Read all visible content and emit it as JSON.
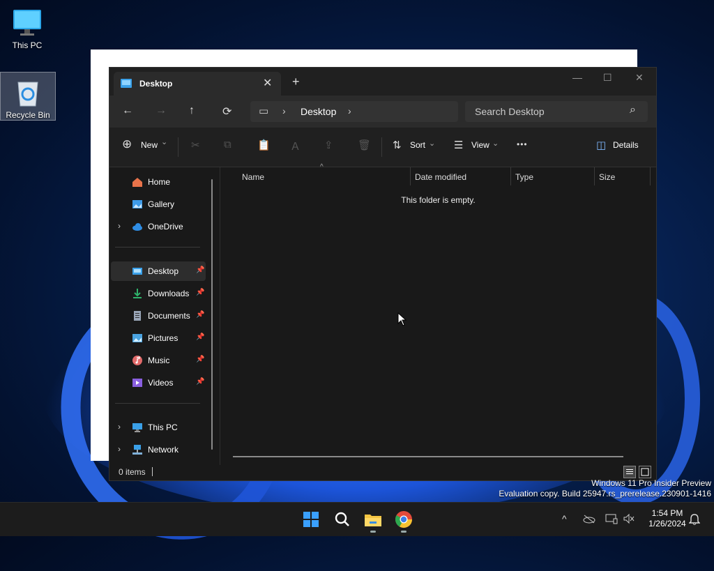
{
  "desktop": {
    "icons": [
      {
        "label": "This PC"
      },
      {
        "label": "Recycle Bin"
      }
    ]
  },
  "explorer": {
    "tab": {
      "title": "Desktop",
      "close": "✕"
    },
    "new_tab": "+",
    "window_controls": {
      "minimize": "—",
      "maximize": "☐",
      "close": "✕"
    },
    "nav": {
      "back": "←",
      "forward": "→",
      "up": "↑",
      "refresh": "⟳"
    },
    "address": {
      "monitor": "▭",
      "sep1": "›",
      "crumb": "Desktop",
      "sep2": "›"
    },
    "search": {
      "placeholder": "Search Desktop",
      "icon": "⌕"
    },
    "toolbar": {
      "new": "New",
      "new_icon": "⊕",
      "chev": "⌄",
      "sort": "Sort",
      "sort_icon": "⇅",
      "view": "View",
      "view_icon": "☰",
      "more": "•••",
      "details": "Details",
      "details_icon": "◫",
      "cut": "✂",
      "copy": "⧉",
      "paste": "📋",
      "rename": "Ａ",
      "share": "⇪",
      "delete": "🗑"
    },
    "sidebar": {
      "chev": "›",
      "pin": "📌",
      "quick": [
        {
          "label": "Home",
          "color": "#e8734a"
        },
        {
          "label": "Gallery",
          "color": "#3d9be9"
        },
        {
          "label": "OneDrive",
          "color": "#2f8de4"
        }
      ],
      "pinned": [
        {
          "label": "Desktop",
          "color": "#3aa0e8"
        },
        {
          "label": "Downloads",
          "color": "#2fb36b"
        },
        {
          "label": "Documents",
          "color": "#9aa6b8"
        },
        {
          "label": "Pictures",
          "color": "#4aa3e0"
        },
        {
          "label": "Music",
          "color": "#e26a6a"
        },
        {
          "label": "Videos",
          "color": "#8a5fe0"
        }
      ],
      "bottom": [
        {
          "label": "This PC",
          "color": "#3aa0e8"
        },
        {
          "label": "Network",
          "color": "#3aa0e8"
        }
      ]
    },
    "columns": {
      "name": "Name",
      "date": "Date modified",
      "type": "Type",
      "size": "Size",
      "sort_caret": "^"
    },
    "empty_message": "This folder is empty.",
    "status": {
      "count": "0 items"
    }
  },
  "watermark": {
    "line1": "Windows 11 Pro Insider Preview",
    "line2": "Evaluation copy. Build 25947.rs_prerelease.230901-1416"
  },
  "taskbar": {
    "tray": {
      "chevron": "^"
    },
    "clock": {
      "time": "1:54 PM",
      "date": "1/26/2024"
    }
  },
  "colors": {
    "accent": "#0078d4",
    "window_bg": "#191919"
  }
}
